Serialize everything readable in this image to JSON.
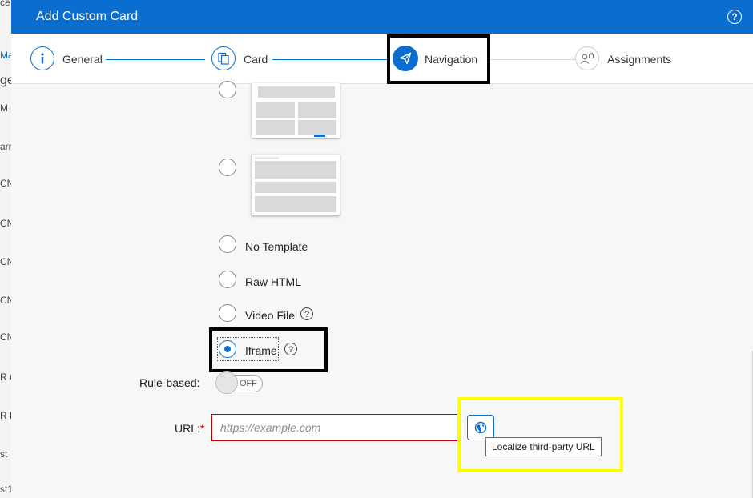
{
  "background_page": {
    "fragments": [
      "ce",
      "Ma",
      "ge",
      "M",
      "arr",
      "CN",
      "CN",
      "CN",
      "CN",
      "CN",
      "R C",
      "R H",
      "st",
      "st1"
    ]
  },
  "dialog": {
    "title": "Add Custom Card",
    "help_icon": "help-icon"
  },
  "wizard": {
    "steps": [
      {
        "label": "General",
        "icon": "info-icon",
        "state": "done"
      },
      {
        "label": "Card",
        "icon": "copy-icon",
        "state": "done"
      },
      {
        "label": "Navigation",
        "icon": "paper-plane-icon",
        "state": "active"
      },
      {
        "label": "Assignments",
        "icon": "people-lock-icon",
        "state": "pending"
      }
    ]
  },
  "template_options": [
    {
      "label": "",
      "type": "thumbnail-grid",
      "selected": false
    },
    {
      "label": "",
      "type": "thumbnail-list",
      "selected": false
    },
    {
      "label": "No Template",
      "selected": false
    },
    {
      "label": "Raw HTML",
      "selected": false
    },
    {
      "label": "Video File",
      "selected": false,
      "help": true
    },
    {
      "label": "Iframe",
      "selected": true,
      "help": true
    }
  ],
  "rule_based": {
    "label": "Rule-based:",
    "state": "OFF"
  },
  "url_field": {
    "label": "URL:",
    "required_marker": "*",
    "value": "",
    "placeholder": "https://example.com"
  },
  "localize_button": {
    "icon": "globe-icon",
    "tooltip": "Localize third-party URL"
  },
  "colors": {
    "header": "#0a6ed1",
    "accent": "#0a6ed1",
    "error": "#bb0000",
    "highlight_black": "#000000",
    "highlight_yellow": "#ffff00"
  }
}
